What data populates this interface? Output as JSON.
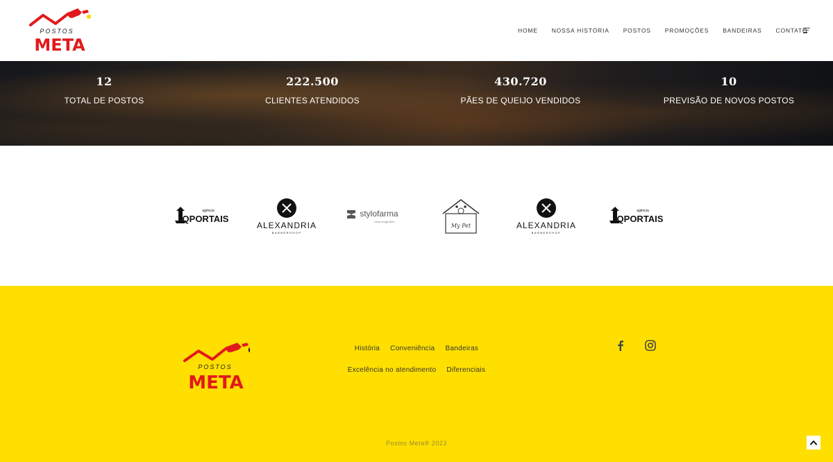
{
  "brand": {
    "line1": "POSTOS",
    "line2": "META",
    "primary_color": "#e2191c",
    "accent_color": "#ffdf00"
  },
  "nav": {
    "items": [
      "HOME",
      "NOSSA HISTÓRIA",
      "POSTOS",
      "PROMOÇÕES",
      "BANDEIRAS",
      "CONTATO"
    ],
    "menu_icon": "hamburger-icon"
  },
  "stats": [
    {
      "value": "12",
      "label": "TOTAL DE POSTOS"
    },
    {
      "value": "222.500",
      "label": "CLIENTES ATENDIDOS"
    },
    {
      "value": "430.720",
      "label": "PÃES DE QUEIJO VENDIDOS"
    },
    {
      "value": "10",
      "label": "PREVISÃO DE NOVOS POSTOS"
    }
  ],
  "partners": [
    {
      "name": "QPORTAIS",
      "small": "agência"
    },
    {
      "name": "ALEXANDRIA",
      "small": "BARBERSHOP"
    },
    {
      "name": "stylofarma",
      "small": "Viva Longa Bem"
    },
    {
      "name": "My Pet",
      "small": ""
    },
    {
      "name": "ALEXANDRIA",
      "small": "BARBERSHOP"
    },
    {
      "name": "QPORTAIS",
      "small": "agência"
    }
  ],
  "footer": {
    "links_row1": [
      "História",
      "Conveniência",
      "Bandeiras"
    ],
    "links_row2": [
      "Excelência no atendimento",
      "Diferenciais"
    ],
    "social": [
      "facebook-icon",
      "instagram-icon"
    ],
    "copyright": "Postos Meta® 2023"
  }
}
